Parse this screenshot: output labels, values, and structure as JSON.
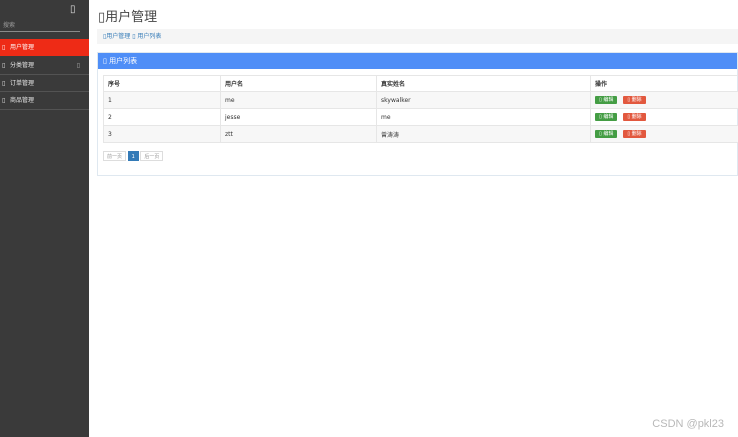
{
  "sidebar": {
    "top_icon": "menu-toggle-icon",
    "top_glyph": "▯",
    "search_placeholder": "搜索",
    "items": [
      {
        "glyph": "▯",
        "label": "用户管理",
        "active": true
      },
      {
        "glyph": "▯",
        "label": "分类管理",
        "chevron": "▯"
      },
      {
        "glyph": "▯",
        "label": "订单管理"
      },
      {
        "glyph": "▯",
        "label": "商品管理"
      }
    ]
  },
  "header": {
    "title": "▯用户管理"
  },
  "breadcrumb": {
    "text": "▯用户管理 ▯ 用户列表"
  },
  "panel": {
    "title": "▯ 用户列表"
  },
  "table": {
    "columns": [
      "序号",
      "用户名",
      "真实姓名",
      "操作"
    ],
    "rows": [
      {
        "id": "1",
        "username": "me",
        "realname": "skywalker"
      },
      {
        "id": "2",
        "username": "jesse",
        "realname": "me"
      },
      {
        "id": "3",
        "username": "ztt",
        "realname": "曾涛涛"
      }
    ],
    "edit_label": "▯ 编辑",
    "delete_label": "▯ 删除"
  },
  "pagination": {
    "prev": "前一页",
    "current": "1",
    "next": "后一页"
  },
  "colors": {
    "sidebar_bg": "#3a3a3a",
    "active_item": "#ee2b16",
    "panel_head": "#4f8ef7",
    "edit": "#449d44",
    "delete": "#e2583e"
  },
  "watermark": "CSDN @pkl23"
}
